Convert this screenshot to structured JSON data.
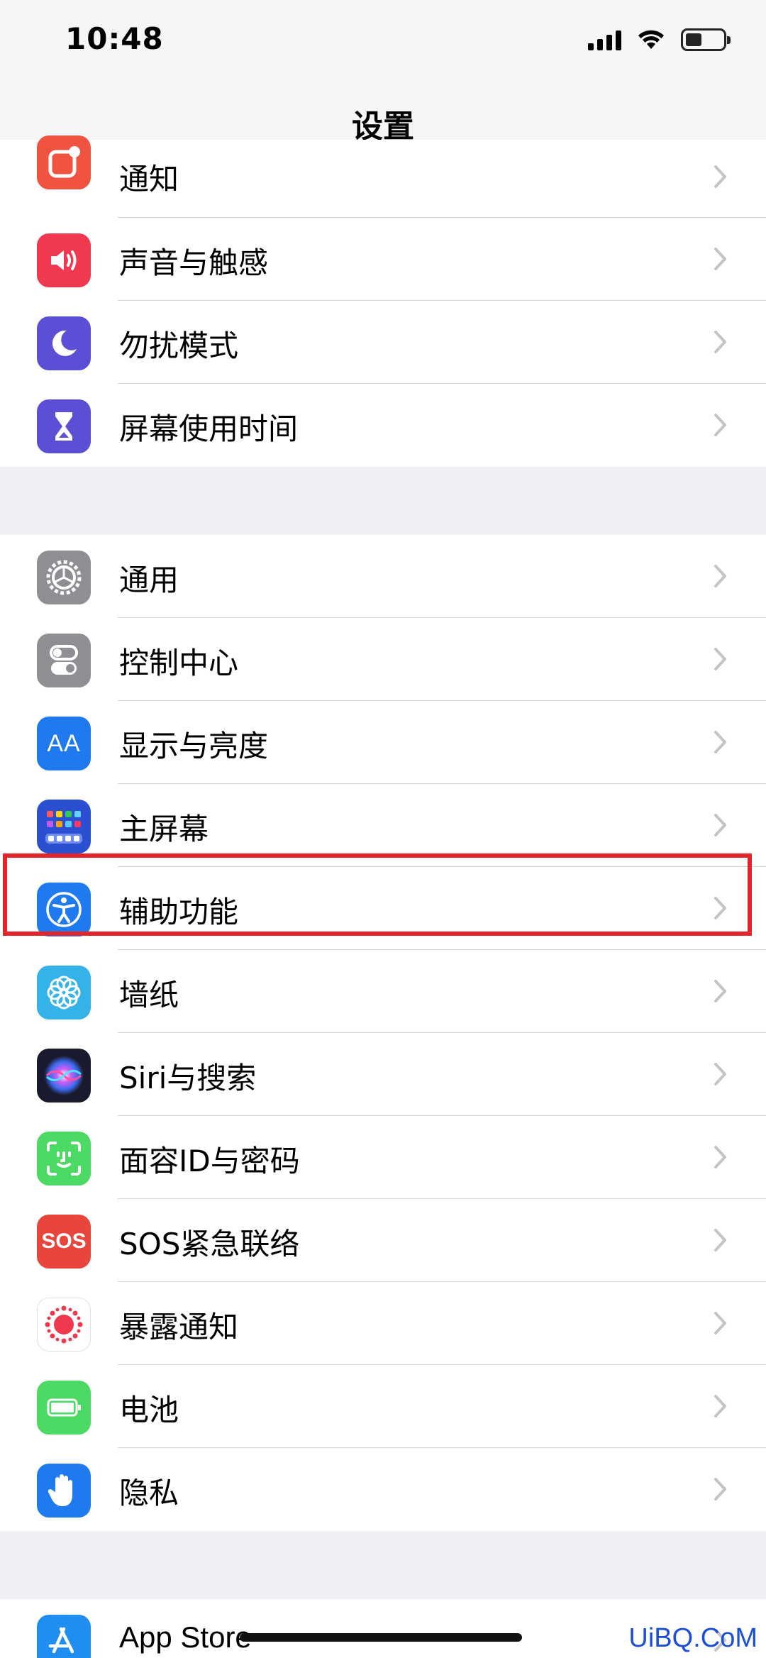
{
  "status": {
    "time": "10:48"
  },
  "nav": {
    "title": "设置"
  },
  "group1": [
    {
      "label": "通知",
      "icon": "notifications-icon",
      "color": "#f0533f"
    },
    {
      "label": "声音与触感",
      "icon": "sound-icon",
      "color": "#f0394f"
    },
    {
      "label": "勿扰模式",
      "icon": "moon-icon",
      "color": "#5b4fd6"
    },
    {
      "label": "屏幕使用时间",
      "icon": "hourglass-icon",
      "color": "#5b4fd6"
    }
  ],
  "group2": [
    {
      "label": "通用",
      "icon": "gear-icon",
      "color": "#8e8e93"
    },
    {
      "label": "控制中心",
      "icon": "toggles-icon",
      "color": "#8e8e93"
    },
    {
      "label": "显示与亮度",
      "icon": "text-size-icon",
      "color": "#1f7af0",
      "glyph": "AA"
    },
    {
      "label": "主屏幕",
      "icon": "home-screen-icon",
      "color": "#2a4fd0"
    },
    {
      "label": "辅助功能",
      "icon": "accessibility-icon",
      "color": "#1f7af0"
    },
    {
      "label": "墙纸",
      "icon": "wallpaper-flower-icon",
      "color": "#35b3e8"
    },
    {
      "label": "Siri与搜索",
      "icon": "siri-icon",
      "color": "#1a1a2e"
    },
    {
      "label": "面容ID与密码",
      "icon": "face-id-icon",
      "color": "#4cd964"
    },
    {
      "label": "SOS紧急联络",
      "icon": "sos-icon",
      "color": "#e8453c",
      "glyph": "SOS"
    },
    {
      "label": "暴露通知",
      "icon": "exposure-icon",
      "color": "#ffffff"
    },
    {
      "label": "电池",
      "icon": "battery-icon",
      "color": "#4cd964"
    },
    {
      "label": "隐私",
      "icon": "hand-icon",
      "color": "#1f7af0"
    }
  ],
  "group3": [
    {
      "label": "App Store",
      "icon": "app-store-icon",
      "color": "#1f8ef0"
    }
  ],
  "watermark": "UiBQ.CoM"
}
